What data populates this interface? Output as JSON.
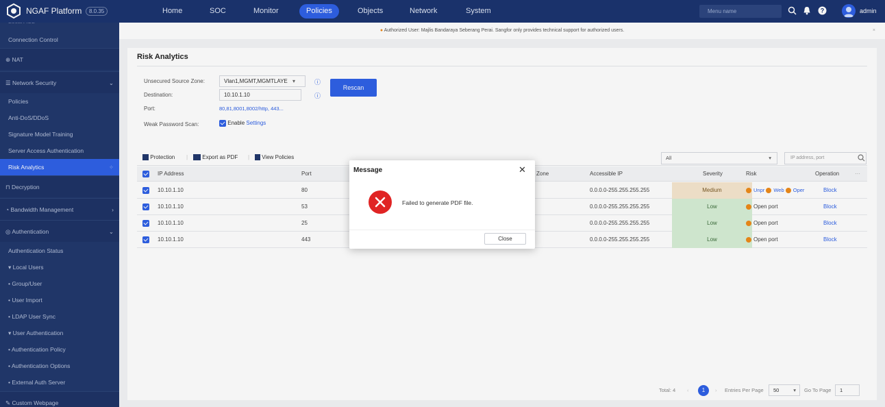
{
  "app": {
    "brand": "NGAF Platform",
    "version": "8.0.35",
    "user": "admin",
    "menu_placeholder": "Menu name"
  },
  "nav": [
    "Home",
    "SOC",
    "Monitor",
    "Policies",
    "Objects",
    "Network",
    "System"
  ],
  "nav_active": "Policies",
  "sidebar": {
    "top_cut": "Local ACL",
    "items": [
      {
        "label": "Connection Control",
        "type": "sub"
      },
      {
        "label": "NAT",
        "type": "head",
        "icon": "globe-icon"
      },
      {
        "label": "Network Security",
        "type": "head",
        "icon": "list-icon",
        "chevron": "⌄"
      },
      {
        "label": "Policies",
        "type": "sub"
      },
      {
        "label": "Anti-DoS/DDoS",
        "type": "sub"
      },
      {
        "label": "Signature Model Training",
        "type": "sub"
      },
      {
        "label": "Server Access Authentication",
        "type": "sub"
      },
      {
        "label": "Risk Analytics",
        "type": "sub",
        "active": true
      },
      {
        "label": "Decryption",
        "type": "head",
        "icon": "lock-icon"
      },
      {
        "label": "Bandwidth Management",
        "type": "head",
        "icon": "gauge-icon",
        "chevron": "›"
      },
      {
        "label": "Authentication",
        "type": "head",
        "icon": "shield-icon",
        "chevron": "⌄"
      },
      {
        "label": "Authentication Status",
        "type": "sub"
      },
      {
        "label": "▾ Local Users",
        "type": "sub"
      },
      {
        "label": "• Group/User",
        "type": "sub"
      },
      {
        "label": "• User Import",
        "type": "sub"
      },
      {
        "label": "• LDAP User Sync",
        "type": "sub"
      },
      {
        "label": "▾ User Authentication",
        "type": "sub"
      },
      {
        "label": "• Authentication Policy",
        "type": "sub"
      },
      {
        "label": "• Authentication Options",
        "type": "sub"
      },
      {
        "label": "• External Auth Server",
        "type": "sub"
      },
      {
        "label": "Custom Webpage",
        "type": "head",
        "icon": "edit-icon"
      }
    ]
  },
  "notice": "Authorized User: Majlis Bandaraya Seberang Perai. Sangfor only provides technical support for authorized users.",
  "panel": {
    "title": "Risk Analytics",
    "labels": {
      "zone": "Unsecured Source Zone:",
      "dest": "Destination:",
      "port": "Port:",
      "weak": "Weak Password Scan:"
    },
    "zone_value": "Vlan1,MGMT,MGMTLAYE",
    "dest_value": "10.10.1.10",
    "port_value": "80,81,8001,8002/http, 443...",
    "enable_label": "Enable",
    "settings_link": "Settings",
    "rescan": "Rescan"
  },
  "toolbar": {
    "protection": "Protection",
    "export_pdf": "Export as PDF",
    "view_policies": "View Policies",
    "filter_value": "All",
    "search_placeholder": "IP address, port"
  },
  "table": {
    "headers": [
      "IP Address",
      "Port",
      "Zone",
      "Accessible IP",
      "Severity",
      "Risk",
      "Operation"
    ],
    "rows": [
      {
        "ip": "10.10.1.10",
        "port": "80",
        "accessible": "0.0.0.0-255.255.255.255",
        "severity": "Medium",
        "risk_a": "Unpr",
        "risk_b": "Web",
        "risk_c": "Oper",
        "op": "Block"
      },
      {
        "ip": "10.10.1.10",
        "port": "53",
        "accessible": "0.0.0.0-255.255.255.255",
        "severity": "Low",
        "risk": "Open port",
        "op": "Block"
      },
      {
        "ip": "10.10.1.10",
        "port": "25",
        "accessible": "0.0.0.0-255.255.255.255",
        "severity": "Low",
        "risk": "Open port",
        "op": "Block"
      },
      {
        "ip": "10.10.1.10",
        "port": "443",
        "accessible": "0.0.0.0-255.255.255.255",
        "severity": "Low",
        "risk": "Open port",
        "op": "Block"
      }
    ]
  },
  "pagination": {
    "total": "Total: 4",
    "page": "1",
    "per_page_label": "Entries Per Page",
    "per_page": "50",
    "goto_label": "Go To Page",
    "goto_value": "1"
  },
  "modal": {
    "title": "Message",
    "message": "Failed to generate PDF file.",
    "close_button": "Close"
  },
  "colors": {
    "topbar": "#1c3570",
    "sidebar": "#22396d",
    "accent": "#2f61e6",
    "error": "#e02424"
  }
}
